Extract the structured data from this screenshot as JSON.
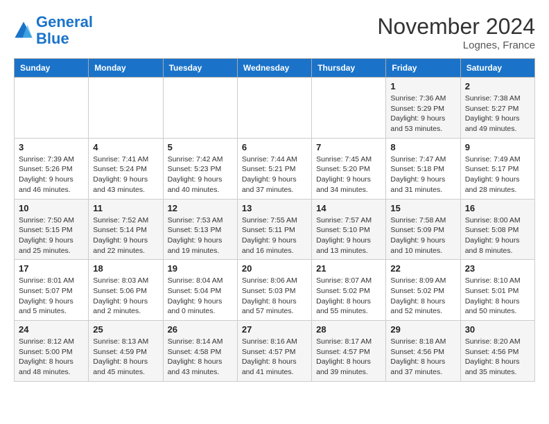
{
  "header": {
    "logo_line1": "General",
    "logo_line2": "Blue",
    "month_title": "November 2024",
    "location": "Lognes, France"
  },
  "weekdays": [
    "Sunday",
    "Monday",
    "Tuesday",
    "Wednesday",
    "Thursday",
    "Friday",
    "Saturday"
  ],
  "weeks": [
    [
      {
        "day": "",
        "info": ""
      },
      {
        "day": "",
        "info": ""
      },
      {
        "day": "",
        "info": ""
      },
      {
        "day": "",
        "info": ""
      },
      {
        "day": "",
        "info": ""
      },
      {
        "day": "1",
        "info": "Sunrise: 7:36 AM\nSunset: 5:29 PM\nDaylight: 9 hours\nand 53 minutes."
      },
      {
        "day": "2",
        "info": "Sunrise: 7:38 AM\nSunset: 5:27 PM\nDaylight: 9 hours\nand 49 minutes."
      }
    ],
    [
      {
        "day": "3",
        "info": "Sunrise: 7:39 AM\nSunset: 5:26 PM\nDaylight: 9 hours\nand 46 minutes."
      },
      {
        "day": "4",
        "info": "Sunrise: 7:41 AM\nSunset: 5:24 PM\nDaylight: 9 hours\nand 43 minutes."
      },
      {
        "day": "5",
        "info": "Sunrise: 7:42 AM\nSunset: 5:23 PM\nDaylight: 9 hours\nand 40 minutes."
      },
      {
        "day": "6",
        "info": "Sunrise: 7:44 AM\nSunset: 5:21 PM\nDaylight: 9 hours\nand 37 minutes."
      },
      {
        "day": "7",
        "info": "Sunrise: 7:45 AM\nSunset: 5:20 PM\nDaylight: 9 hours\nand 34 minutes."
      },
      {
        "day": "8",
        "info": "Sunrise: 7:47 AM\nSunset: 5:18 PM\nDaylight: 9 hours\nand 31 minutes."
      },
      {
        "day": "9",
        "info": "Sunrise: 7:49 AM\nSunset: 5:17 PM\nDaylight: 9 hours\nand 28 minutes."
      }
    ],
    [
      {
        "day": "10",
        "info": "Sunrise: 7:50 AM\nSunset: 5:15 PM\nDaylight: 9 hours\nand 25 minutes."
      },
      {
        "day": "11",
        "info": "Sunrise: 7:52 AM\nSunset: 5:14 PM\nDaylight: 9 hours\nand 22 minutes."
      },
      {
        "day": "12",
        "info": "Sunrise: 7:53 AM\nSunset: 5:13 PM\nDaylight: 9 hours\nand 19 minutes."
      },
      {
        "day": "13",
        "info": "Sunrise: 7:55 AM\nSunset: 5:11 PM\nDaylight: 9 hours\nand 16 minutes."
      },
      {
        "day": "14",
        "info": "Sunrise: 7:57 AM\nSunset: 5:10 PM\nDaylight: 9 hours\nand 13 minutes."
      },
      {
        "day": "15",
        "info": "Sunrise: 7:58 AM\nSunset: 5:09 PM\nDaylight: 9 hours\nand 10 minutes."
      },
      {
        "day": "16",
        "info": "Sunrise: 8:00 AM\nSunset: 5:08 PM\nDaylight: 9 hours\nand 8 minutes."
      }
    ],
    [
      {
        "day": "17",
        "info": "Sunrise: 8:01 AM\nSunset: 5:07 PM\nDaylight: 9 hours\nand 5 minutes."
      },
      {
        "day": "18",
        "info": "Sunrise: 8:03 AM\nSunset: 5:06 PM\nDaylight: 9 hours\nand 2 minutes."
      },
      {
        "day": "19",
        "info": "Sunrise: 8:04 AM\nSunset: 5:04 PM\nDaylight: 9 hours\nand 0 minutes."
      },
      {
        "day": "20",
        "info": "Sunrise: 8:06 AM\nSunset: 5:03 PM\nDaylight: 8 hours\nand 57 minutes."
      },
      {
        "day": "21",
        "info": "Sunrise: 8:07 AM\nSunset: 5:02 PM\nDaylight: 8 hours\nand 55 minutes."
      },
      {
        "day": "22",
        "info": "Sunrise: 8:09 AM\nSunset: 5:02 PM\nDaylight: 8 hours\nand 52 minutes."
      },
      {
        "day": "23",
        "info": "Sunrise: 8:10 AM\nSunset: 5:01 PM\nDaylight: 8 hours\nand 50 minutes."
      }
    ],
    [
      {
        "day": "24",
        "info": "Sunrise: 8:12 AM\nSunset: 5:00 PM\nDaylight: 8 hours\nand 48 minutes."
      },
      {
        "day": "25",
        "info": "Sunrise: 8:13 AM\nSunset: 4:59 PM\nDaylight: 8 hours\nand 45 minutes."
      },
      {
        "day": "26",
        "info": "Sunrise: 8:14 AM\nSunset: 4:58 PM\nDaylight: 8 hours\nand 43 minutes."
      },
      {
        "day": "27",
        "info": "Sunrise: 8:16 AM\nSunset: 4:57 PM\nDaylight: 8 hours\nand 41 minutes."
      },
      {
        "day": "28",
        "info": "Sunrise: 8:17 AM\nSunset: 4:57 PM\nDaylight: 8 hours\nand 39 minutes."
      },
      {
        "day": "29",
        "info": "Sunrise: 8:18 AM\nSunset: 4:56 PM\nDaylight: 8 hours\nand 37 minutes."
      },
      {
        "day": "30",
        "info": "Sunrise: 8:20 AM\nSunset: 4:56 PM\nDaylight: 8 hours\nand 35 minutes."
      }
    ]
  ]
}
